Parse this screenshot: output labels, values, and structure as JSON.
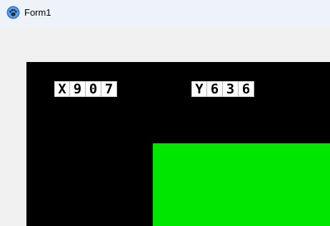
{
  "window": {
    "title": "Form1",
    "icon": "paw-icon"
  },
  "canvas": {
    "background": "#000000",
    "x_readout": {
      "chars": [
        "X",
        "9",
        "0",
        "7"
      ]
    },
    "y_readout": {
      "chars": [
        "Y",
        "6",
        "3",
        "6"
      ]
    },
    "block": {
      "color": "#00e600"
    }
  }
}
